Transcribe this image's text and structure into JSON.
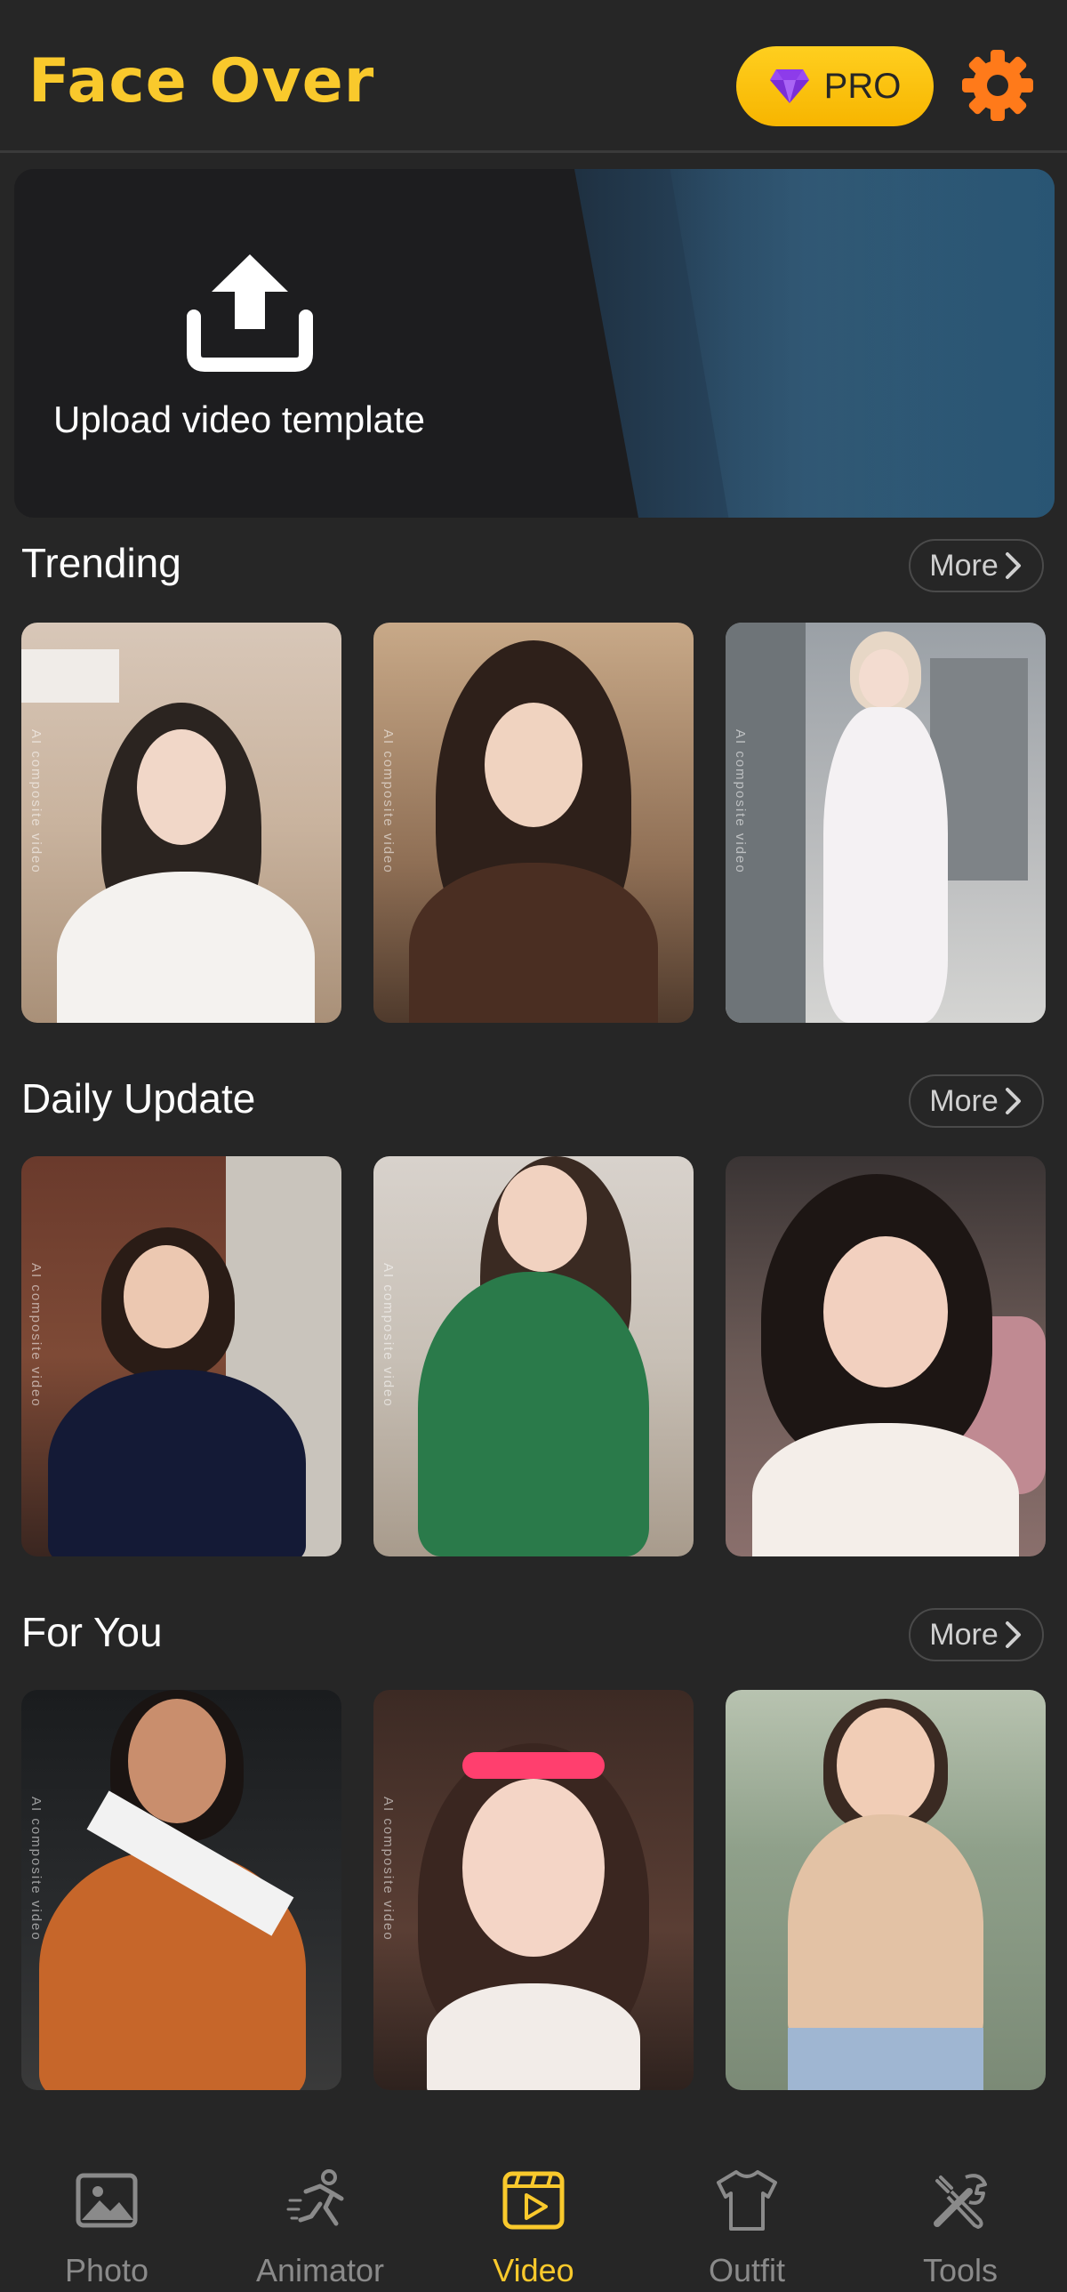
{
  "header": {
    "title": "Face Over",
    "pro_label": "PRO",
    "pro_icon": "diamond-icon",
    "settings_icon": "gear-icon"
  },
  "colors": {
    "accent": "#f9c92c",
    "pro_background": "#ffc51a",
    "pro_diamond": "#8a2be2",
    "settings": "#ff7a1a",
    "background": "#262626",
    "nav_inactive": "#8a8a8a"
  },
  "upload": {
    "label": "Upload video template",
    "icon": "upload-icon"
  },
  "sections": [
    {
      "title": "Trending",
      "more_label": "More",
      "items": [
        {
          "watermark": "AI composite video"
        },
        {
          "watermark": "AI composite video"
        },
        {
          "watermark": "AI composite video"
        }
      ]
    },
    {
      "title": "Daily Update",
      "more_label": "More",
      "items": [
        {
          "watermark": "AI composite video"
        },
        {
          "watermark": "AI composite video"
        },
        {
          "watermark": ""
        }
      ]
    },
    {
      "title": "For You",
      "more_label": "More",
      "items": [
        {
          "watermark": "AI composite video"
        },
        {
          "watermark": "AI composite video"
        },
        {
          "watermark": ""
        }
      ]
    }
  ],
  "nav": {
    "items": [
      {
        "label": "Photo",
        "icon": "image-icon",
        "active": false
      },
      {
        "label": "Animator",
        "icon": "running-figure-icon",
        "active": false
      },
      {
        "label": "Video",
        "icon": "video-play-icon",
        "active": true
      },
      {
        "label": "Outfit",
        "icon": "tshirt-icon",
        "active": false
      },
      {
        "label": "Tools",
        "icon": "tools-icon",
        "active": false
      }
    ]
  }
}
